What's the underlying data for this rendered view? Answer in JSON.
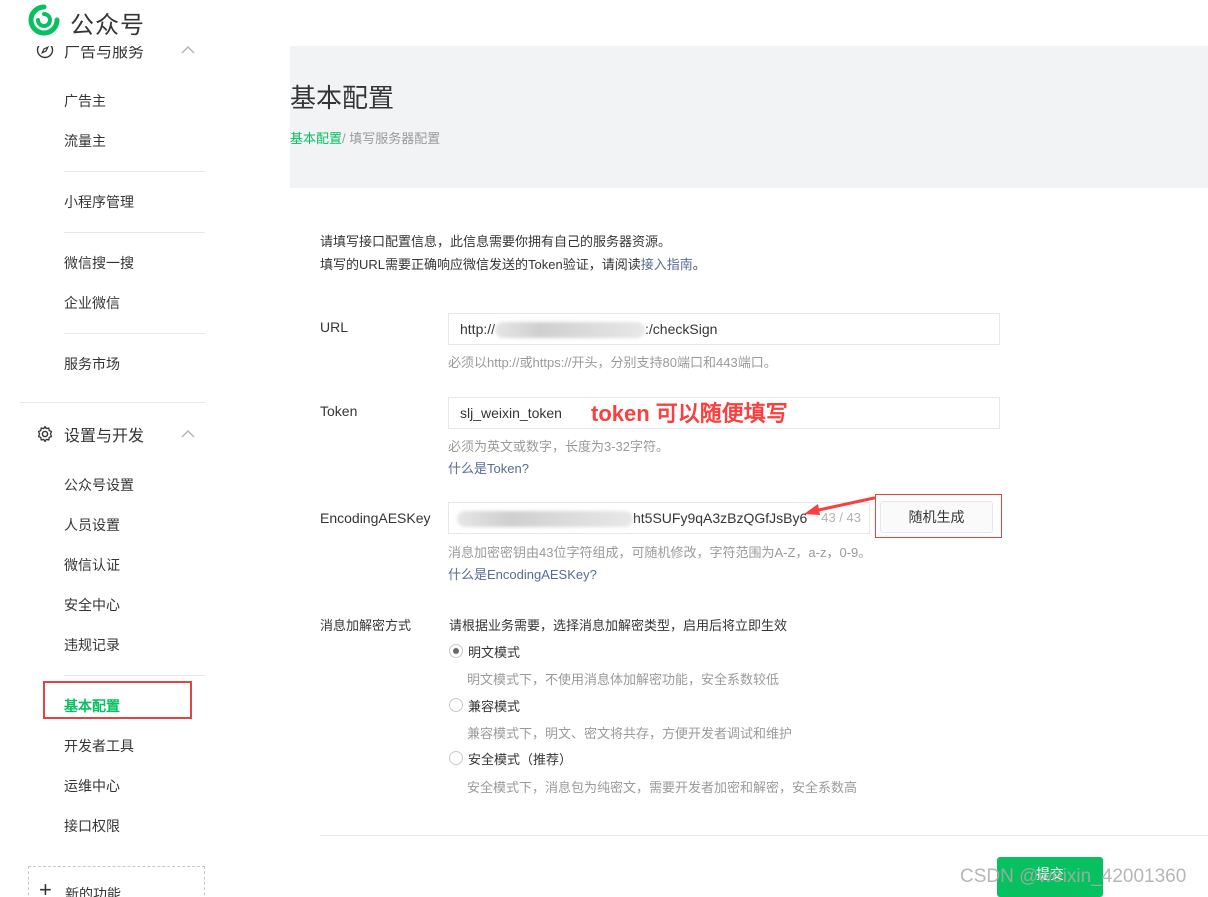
{
  "header": {
    "brand": "公众号"
  },
  "sidebar": {
    "group_ads": {
      "label": "广告与服务"
    },
    "ads_items": [
      "广告主",
      "流量主"
    ],
    "mini_items": [
      "小程序管理"
    ],
    "search_items": [
      "微信搜一搜",
      "企业微信"
    ],
    "market_items": [
      "服务市场"
    ],
    "group_settings": {
      "label": "设置与开发"
    },
    "settings_items": [
      "公众号设置",
      "人员设置",
      "微信认证",
      "安全中心",
      "违规记录"
    ],
    "dev_items": [
      "基本配置",
      "开发者工具",
      "运维中心",
      "接口权限"
    ],
    "active_item": "基本配置",
    "new_function": "新的功能"
  },
  "main": {
    "title": "基本配置",
    "breadcrumb": {
      "link": "基本配置",
      "current": "/ 填写服务器配置"
    },
    "intro_line1": "请填写接口配置信息，此信息需要你拥有自己的服务器资源。",
    "intro_line2_prefix": "填写的URL需要正确响应微信发送的Token验证，请阅读",
    "intro_line2_link": "接入指南",
    "intro_line2_suffix": "。",
    "url": {
      "label": "URL",
      "value_prefix": "http://",
      "value_suffix": ":/checkSign",
      "tip": "必须以http://或https://开头，分别支持80端口和443端口。"
    },
    "token": {
      "label": "Token",
      "value": "slj_weixin_token",
      "annotation": "token 可以随便填写",
      "tip": "必须为英文或数字，长度为3-32字符。",
      "help_link": "什么是Token?"
    },
    "aes": {
      "label": "EncodingAESKey",
      "value_visible": "ht5SUFy9qA3zBzQGfJsBy6",
      "counter": "43 / 43",
      "generate_button": "随机生成",
      "tip": "消息加密密钥由43位字符组成，可随机修改，字符范围为A-Z，a-z，0-9。",
      "help_link": "什么是EncodingAESKey?"
    },
    "encryption": {
      "label": "消息加解密方式",
      "hint": "请根据业务需要，选择消息加解密类型，启用后将立即生效",
      "options": [
        {
          "label": "明文模式",
          "desc": "明文模式下，不使用消息体加解密功能，安全系数较低",
          "selected": true
        },
        {
          "label": "兼容模式",
          "desc": "兼容模式下，明文、密文将共存，方便开发者调试和维护",
          "selected": false
        },
        {
          "label": "安全模式（推荐）",
          "desc": "安全模式下，消息包为纯密文，需要开发者加密和解密，安全系数高",
          "selected": false
        }
      ]
    },
    "submit_button": "提交",
    "watermark": "CSDN @weixin_42001360"
  },
  "colors": {
    "accent": "#07c160",
    "link": "#576b95",
    "annotation": "#fa3f3f",
    "highlight_border": "#e34444"
  }
}
